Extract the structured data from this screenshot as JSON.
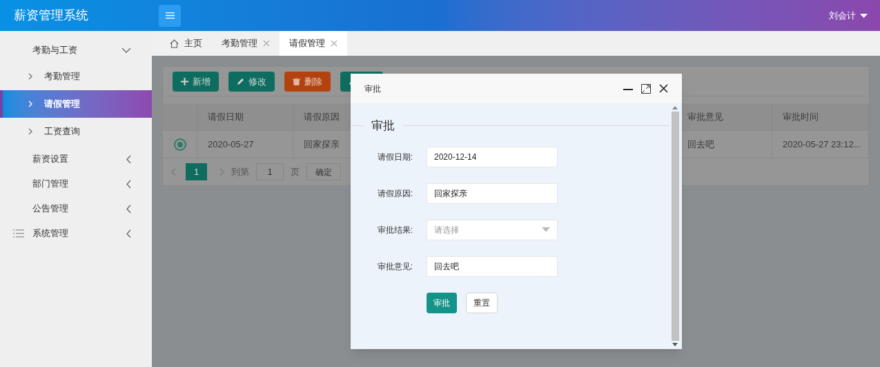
{
  "header": {
    "title": "薪资管理系统",
    "user": "刘会计"
  },
  "sidebar": {
    "items": [
      {
        "label": "考勤与工资",
        "expanded": true,
        "children": [
          {
            "label": "考勤管理",
            "selected": false
          },
          {
            "label": "请假管理",
            "selected": true
          },
          {
            "label": "工资查询",
            "selected": false
          }
        ]
      },
      {
        "label": "薪资设置",
        "expanded": false
      },
      {
        "label": "部门管理",
        "expanded": false
      },
      {
        "label": "公告管理",
        "expanded": false
      },
      {
        "label": "系统管理",
        "expanded": false,
        "kind": "list"
      }
    ]
  },
  "tabs": [
    {
      "label": "主页",
      "kind": "home",
      "selected": false
    },
    {
      "label": "考勤管理",
      "kind": "closable",
      "selected": false
    },
    {
      "label": "请假管理",
      "kind": "closable",
      "selected": true
    }
  ],
  "toolbar": [
    {
      "label": "新增",
      "kind": "add"
    },
    {
      "label": "修改",
      "kind": "edit"
    },
    {
      "label": "删除",
      "kind": "delete"
    },
    {
      "kind": "edit-hidden"
    }
  ],
  "table": {
    "columns": [
      "请假日期",
      "请假原因",
      "审批意见",
      "审批时间"
    ],
    "rows": [
      {
        "selected": true,
        "cells": [
          "2020-05-27",
          "回家探亲",
          "回去吧",
          "2020-05-27 23:12..."
        ]
      }
    ]
  },
  "pagination": {
    "page": "1",
    "goto_label": "到第",
    "goto_value": "1",
    "page_unit": "页",
    "confirm": "确定"
  },
  "dialog": {
    "title": "审批",
    "legend": "审批",
    "fields": [
      {
        "label": "请假日期:",
        "kind": "input",
        "value": "2020-12-14"
      },
      {
        "label": "请假原因:",
        "kind": "input",
        "value": "回家探亲"
      },
      {
        "label": "审批结果:",
        "kind": "select",
        "placeholder": "请选择"
      },
      {
        "label": "审批意见:",
        "kind": "input",
        "value": "回去吧"
      }
    ],
    "buttons": [
      {
        "label": "审批",
        "kind": "primary"
      },
      {
        "label": "重置",
        "kind": "default"
      }
    ]
  }
}
